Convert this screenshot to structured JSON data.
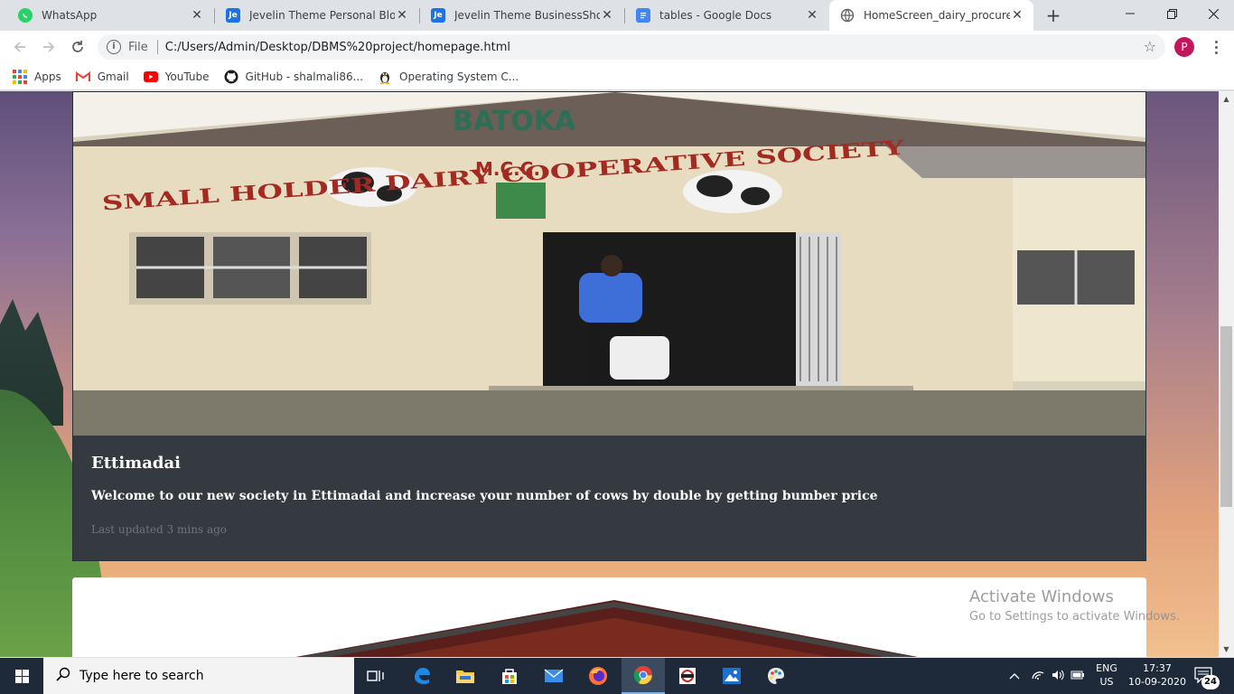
{
  "browser": {
    "tabs": [
      {
        "title": "WhatsApp",
        "icon": "whatsapp-icon",
        "active": false
      },
      {
        "title": "Jevelin Theme Personal Blog D",
        "icon": "jevelin-icon",
        "active": false
      },
      {
        "title": "Jevelin Theme BusinessShop D",
        "icon": "jevelin-icon",
        "active": false
      },
      {
        "title": "tables - Google Docs",
        "icon": "google-docs-icon",
        "active": false
      },
      {
        "title": "HomeScreen_dairy_procureme",
        "icon": "globe-icon",
        "active": true
      }
    ],
    "favicon_text": {
      "jevelin": "Je"
    },
    "address": {
      "scheme_label": "File",
      "url": "C:/Users/Admin/Desktop/DBMS%20project/homepage.html"
    },
    "profile_initial": "P",
    "bookmarks": [
      {
        "label": "Apps",
        "icon": "apps-grid-icon"
      },
      {
        "label": "Gmail",
        "icon": "gmail-icon"
      },
      {
        "label": "YouTube",
        "icon": "youtube-icon"
      },
      {
        "label": "GitHub - shalmali86...",
        "icon": "github-icon"
      },
      {
        "label": "Operating System C...",
        "icon": "linux-tux-icon"
      }
    ]
  },
  "page": {
    "card": {
      "image_sign": {
        "line1": "BATOKA",
        "line2": "SMALL HOLDER DAIRY COOPERATIVE SOCIETY",
        "line3": "M.C.C."
      },
      "title": "Ettimadai",
      "text": "Welcome to our new society in Ettimadai and increase your number of cows by double by getting bumber price",
      "updated": "Last updated 3 mins ago"
    }
  },
  "watermark": {
    "title": "Activate Windows",
    "subtitle": "Go to Settings to activate Windows."
  },
  "taskbar": {
    "search_placeholder": "Type here to search",
    "pinned": [
      "task-view-icon",
      "edge-icon",
      "file-explorer-icon",
      "store-icon",
      "mail-icon",
      "firefox-icon",
      "chrome-icon",
      "app-icon",
      "photos-icon",
      "paint-icon"
    ],
    "lang_line1": "ENG",
    "lang_line2": "US",
    "time": "17:37",
    "date": "10-09-2020",
    "notifications": "24"
  },
  "colors": {
    "card_body": "#343a40",
    "tab_strip": "#dee1e6",
    "taskbar": "#1e2a3a",
    "profile": "#c2185b"
  }
}
